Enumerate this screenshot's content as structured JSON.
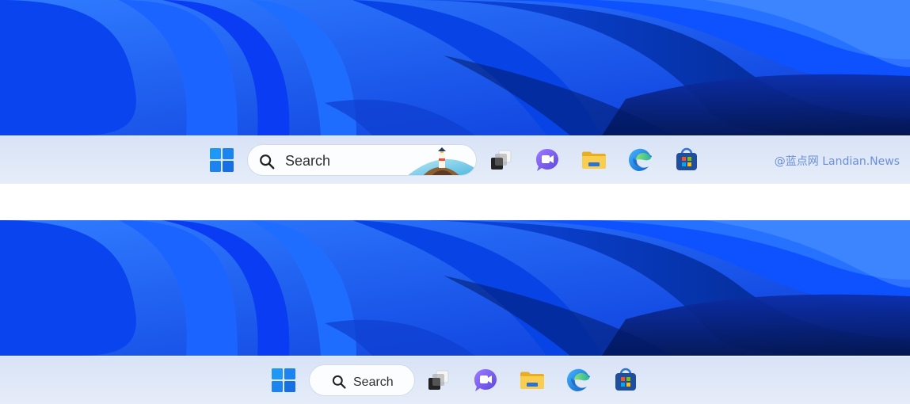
{
  "windowA": {
    "search_label": "Search",
    "icons": {
      "start": "windows-logo-icon",
      "search": "search-icon",
      "task_view": "task-view-icon",
      "chat": "chat-video-icon",
      "file_explorer": "folder-icon",
      "edge": "edge-browser-icon",
      "store": "store-bag-icon",
      "search_highlight": "lighthouse-illustration-icon"
    },
    "watermark": "@蓝点网 Landian.News"
  },
  "windowB": {
    "search_label": "Search",
    "icons": {
      "start": "windows-logo-icon",
      "search": "search-icon",
      "task_view": "task-view-icon",
      "chat": "chat-video-icon",
      "file_explorer": "folder-icon",
      "edge": "edge-browser-icon",
      "store": "store-bag-icon"
    }
  },
  "colors": {
    "wallpaper_blue": "#0f58ff",
    "taskbar_bg": "#e0e8f7",
    "search_bg": "#fbfdff",
    "start_blue": "#1d8ff5",
    "chat_purple": "#7a5cf4",
    "folder_yellow": "#f7c443",
    "edge_blue": "#1c74d8",
    "edge_green": "#57c56d",
    "store_navy": "#1f4e9c"
  }
}
